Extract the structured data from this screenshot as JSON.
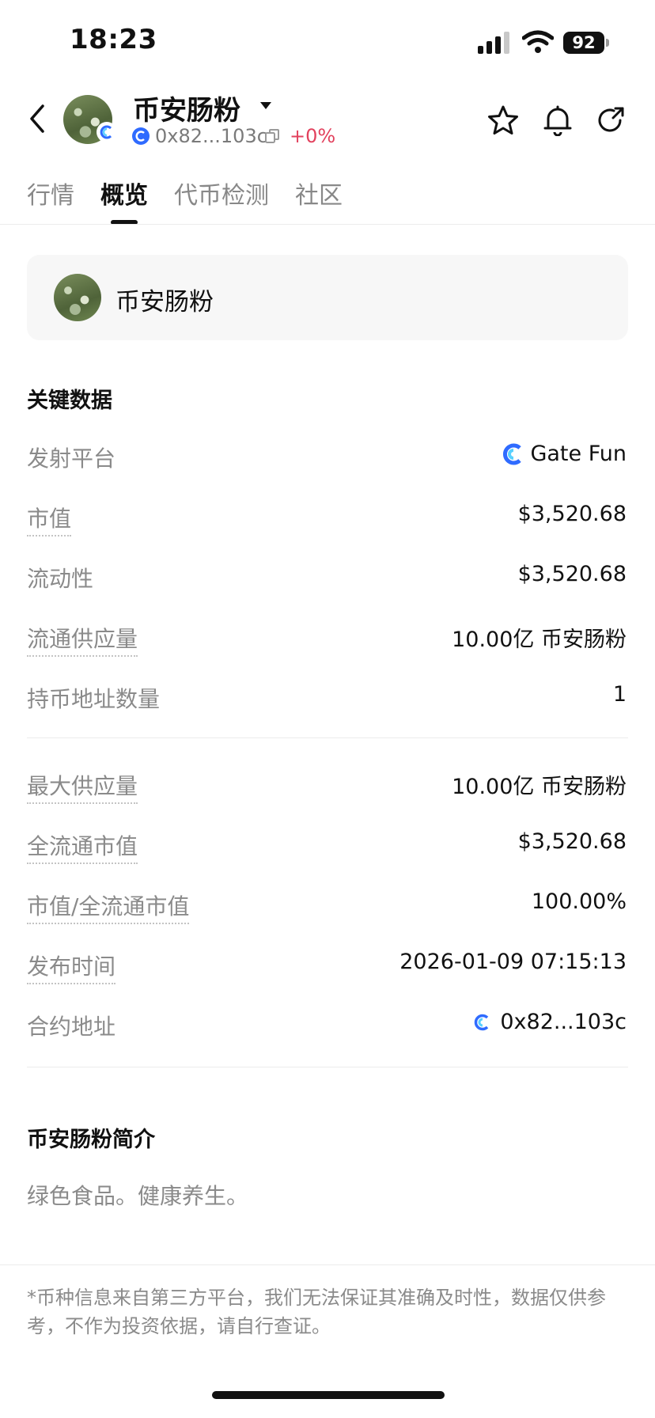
{
  "status_bar": {
    "time": "18:23",
    "battery": "92"
  },
  "header": {
    "token_name": "币安肠粉",
    "address": "0x82...103c",
    "change": "+0%"
  },
  "tabs": [
    {
      "label": "行情",
      "active": false
    },
    {
      "label": "概览",
      "active": true
    },
    {
      "label": "代币检测",
      "active": false
    },
    {
      "label": "社区",
      "active": false
    }
  ],
  "token_card": {
    "name": "币安肠粉"
  },
  "key_data": {
    "title": "关键数据",
    "rows": [
      {
        "label": "发射平台",
        "value": "Gate Fun"
      },
      {
        "label": "市值",
        "value": "$3,520.68"
      },
      {
        "label": "流动性",
        "value": "$3,520.68"
      },
      {
        "label": "流通供应量",
        "value": "10.00亿 币安肠粉"
      },
      {
        "label": "持币地址数量",
        "value": "1"
      },
      {
        "label": "最大供应量",
        "value": "10.00亿 币安肠粉"
      },
      {
        "label": "全流通市值",
        "value": "$3,520.68"
      },
      {
        "label": "市值/全流通市值",
        "value": "100.00%"
      },
      {
        "label": "发布时间",
        "value": "2026-01-09 07:15:13"
      },
      {
        "label": "合约地址",
        "value": "0x82...103c"
      }
    ]
  },
  "intro": {
    "title": "币安肠粉简介",
    "text": "绿色食品。健康养生。"
  },
  "disclaimer": "*币种信息来自第三方平台，我们无法保证其准确及时性，数据仅供参考，不作为投资依据，请自行查证。",
  "colors": {
    "change": "#e2415d",
    "accent_blue": "#2f6bff"
  }
}
